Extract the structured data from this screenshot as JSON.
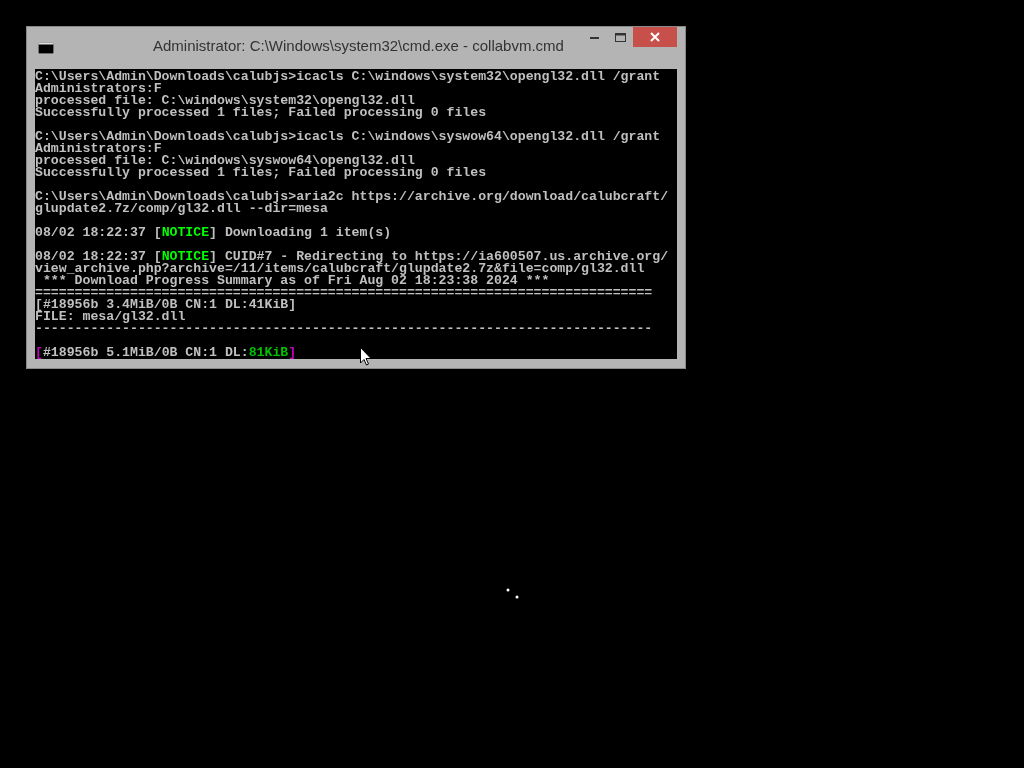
{
  "window": {
    "title": "Administrator: C:\\Windows\\system32\\cmd.exe - collabvm.cmd"
  },
  "console": {
    "blocks": [
      [
        [
          {
            "text": "C:\\Users\\Admin\\Downloads\\calubjs>icacls C:\\windows\\system32\\opengl32.dll /grant",
            "kind": "plain"
          }
        ],
        [
          {
            "text": "Administrators:F",
            "kind": "plain"
          }
        ],
        [
          {
            "text": "processed file: C:\\windows\\system32\\opengl32.dll",
            "kind": "plain"
          }
        ],
        [
          {
            "text": "Successfully processed 1 files; Failed processing 0 files",
            "kind": "plain"
          }
        ]
      ],
      [
        [
          {
            "text": "C:\\Users\\Admin\\Downloads\\calubjs>icacls C:\\windows\\syswow64\\opengl32.dll /grant",
            "kind": "plain"
          }
        ],
        [
          {
            "text": "Administrators:F",
            "kind": "plain"
          }
        ],
        [
          {
            "text": "processed file: C:\\windows\\syswow64\\opengl32.dll",
            "kind": "plain"
          }
        ],
        [
          {
            "text": "Successfully processed 1 files; Failed processing 0 files",
            "kind": "plain"
          }
        ]
      ],
      [
        [
          {
            "text": "C:\\Users\\Admin\\Downloads\\calubjs>aria2c https://archive.org/download/calubcraft/",
            "kind": "plain"
          }
        ],
        [
          {
            "text": "glupdate2.7z/comp/gl32.dll --dir=mesa",
            "kind": "plain"
          }
        ]
      ],
      [
        [
          {
            "text": "08/02 18:22:37 [",
            "kind": "plain"
          },
          {
            "text": "NOTICE",
            "kind": "notice"
          },
          {
            "text": "] Downloading 1 item(s)",
            "kind": "plain"
          }
        ]
      ],
      [
        [
          {
            "text": "08/02 18:22:37 [",
            "kind": "plain"
          },
          {
            "text": "NOTICE",
            "kind": "notice"
          },
          {
            "text": "] CUID#7 - Redirecting to https://ia600507.us.archive.org/",
            "kind": "plain"
          }
        ],
        [
          {
            "text": "view_archive.php?archive=/11/items/calubcraft/glupdate2.7z&file=comp/gl32.dll",
            "kind": "plain"
          }
        ],
        [
          {
            "text": " *** Download Progress Summary as of Fri Aug 02 18:23:38 2024 ***",
            "kind": "plain"
          }
        ],
        [
          {
            "text": "==============================================================================",
            "kind": "plain"
          }
        ],
        [
          {
            "text": "[#18956b 3.4MiB/0B CN:1 DL:41KiB]",
            "kind": "plain"
          }
        ],
        [
          {
            "text": "FILE: mesa/gl32.dll",
            "kind": "plain"
          }
        ],
        [
          {
            "text": "------------------------------------------------------------------------------",
            "kind": "plain"
          }
        ]
      ],
      [
        [
          {
            "text": "[",
            "kind": "bracket"
          },
          {
            "text": "#18956b 5.1MiB/0B CN:1 DL:",
            "kind": "plain"
          },
          {
            "text": "81KiB",
            "kind": "speed"
          },
          {
            "text": "]",
            "kind": "bracket"
          }
        ]
      ]
    ]
  }
}
